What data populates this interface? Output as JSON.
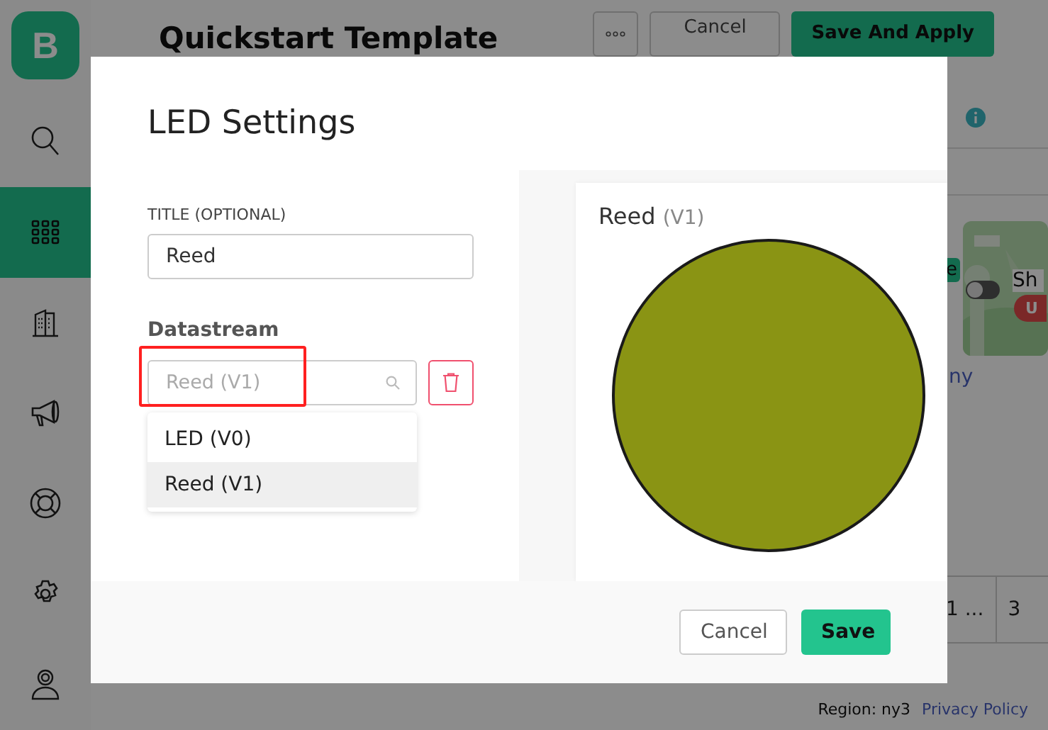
{
  "sidebar": {
    "logo": "B",
    "items": [
      {
        "kind": "search",
        "selected": false
      },
      {
        "kind": "grid",
        "selected": true
      },
      {
        "kind": "building",
        "selected": false
      },
      {
        "kind": "megaphone",
        "selected": false
      },
      {
        "kind": "lifebuoy",
        "selected": false
      },
      {
        "kind": "gear",
        "selected": false
      },
      {
        "kind": "user",
        "selected": false
      }
    ]
  },
  "header": {
    "title": "Quickstart Template",
    "buttons": [
      {
        "label": "Cancel",
        "kind": "secondary"
      },
      {
        "label": "Save And Apply",
        "kind": "primary"
      }
    ]
  },
  "background_fragments": {
    "chip": "e",
    "toggle_on": false,
    "card_title": "Sh",
    "badge": "U",
    "link": "ny",
    "cells": [
      "1 ...",
      "3"
    ]
  },
  "page_footer": {
    "region": "Region: ny3",
    "link": "Privacy Policy"
  },
  "modal": {
    "title": "LED Settings",
    "title_field": {
      "label": "TITLE (OPTIONAL)",
      "value": "Reed"
    },
    "datastream": {
      "label": "Datastream",
      "placeholder": "Reed (V1)",
      "options": [
        {
          "label": "LED (V0)",
          "selected": false
        },
        {
          "label": "Reed (V1)",
          "selected": true
        }
      ]
    },
    "preview": {
      "title": "Reed",
      "pin": "(V1)"
    },
    "buttons": [
      {
        "label": "Cancel",
        "kind": "secondary"
      },
      {
        "label": "Save",
        "kind": "primary"
      }
    ]
  }
}
